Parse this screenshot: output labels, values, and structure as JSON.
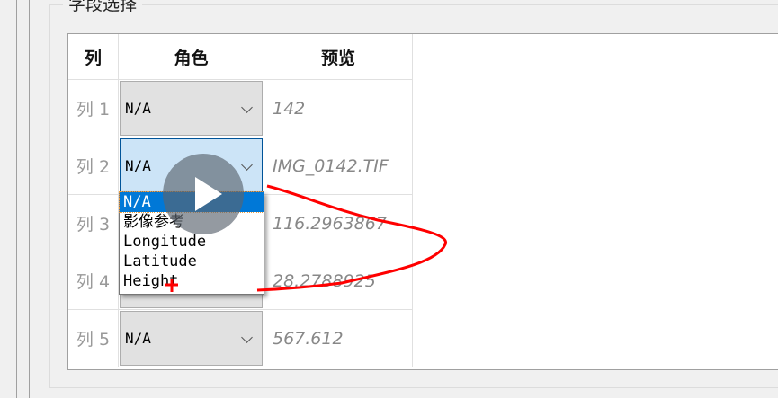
{
  "group_title": "字段选择",
  "headers": [
    "列",
    "角色",
    "预览"
  ],
  "rows": [
    {
      "label": "列 1",
      "role": "N/A",
      "preview": "142"
    },
    {
      "label": "列 2",
      "role": "N/A",
      "preview": "IMG_0142.TIF"
    },
    {
      "label": "列 3",
      "role": "",
      "preview": "116.2963867"
    },
    {
      "label": "列 4",
      "role": "",
      "preview": "28.2788925"
    },
    {
      "label": "列 5",
      "role": "N/A",
      "preview": "567.612"
    }
  ],
  "dropdown_options": [
    "N/A",
    "影像参考",
    "Longitude",
    "Latitude",
    "Height"
  ],
  "selected_option": "N/A"
}
